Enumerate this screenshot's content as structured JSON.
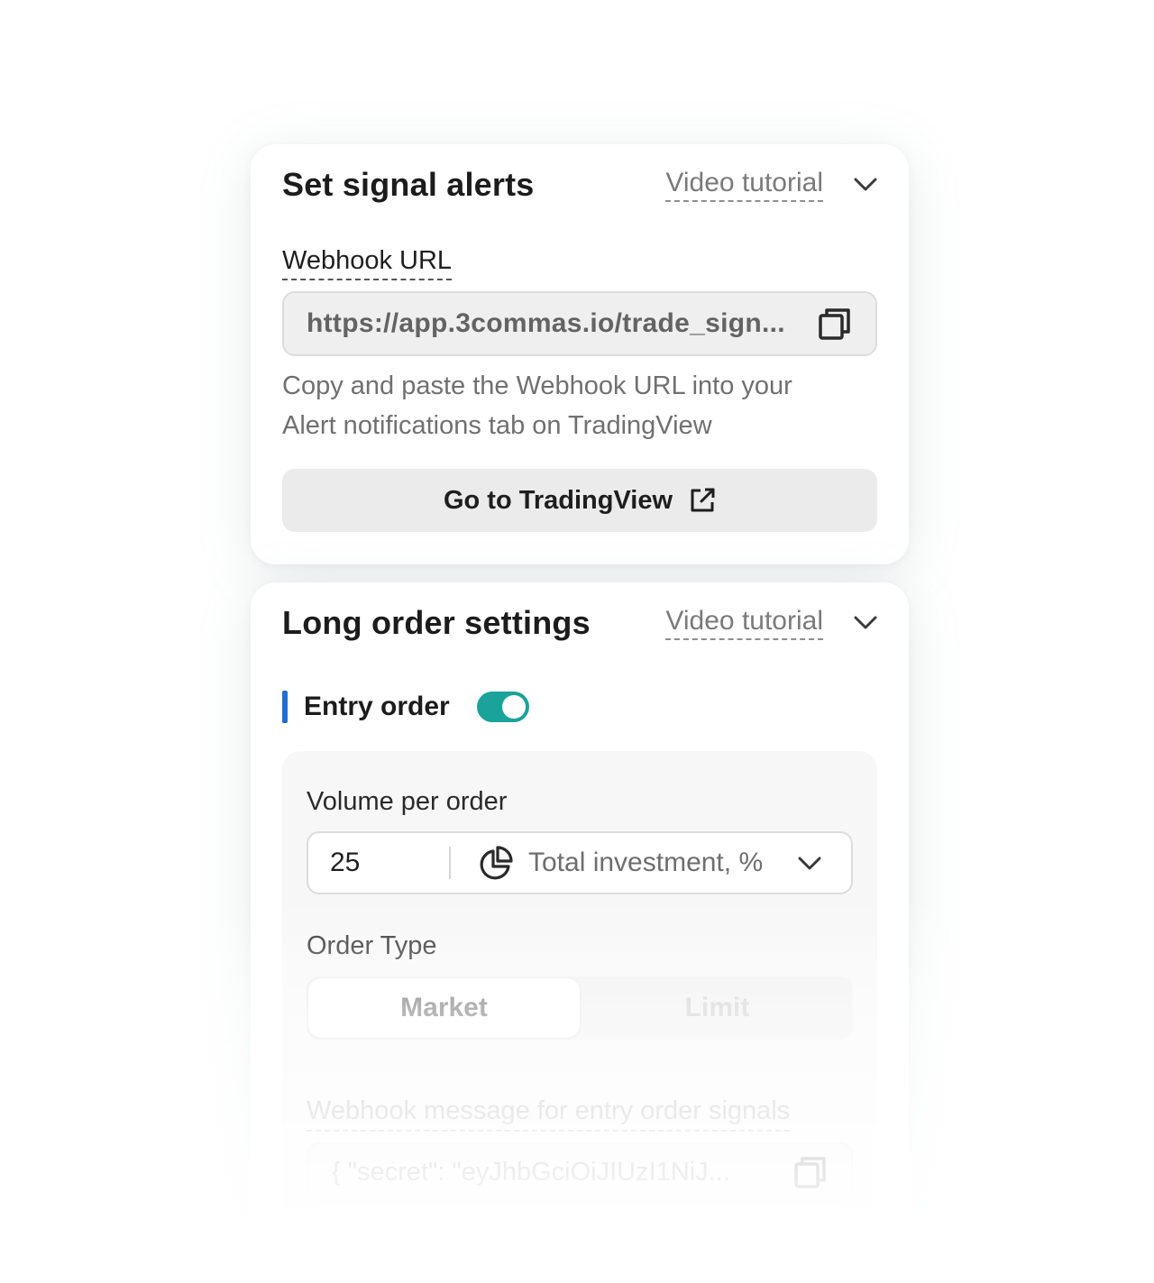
{
  "signal_alerts": {
    "title": "Set signal alerts",
    "video_tutorial": "Video tutorial",
    "webhook_label": "Webhook URL",
    "webhook_url": "https://app.3commas.io/trade_sign...",
    "helper_line1": "Copy and paste the Webhook URL into your",
    "helper_line2": "Alert notifications tab on TradingView",
    "go_button": "Go to TradingView"
  },
  "long_order": {
    "title": "Long order settings",
    "video_tutorial": "Video tutorial",
    "entry_order_label": "Entry order",
    "entry_order_enabled": true,
    "volume_label": "Volume per order",
    "volume_value": "25",
    "volume_unit": "Total investment, %",
    "order_type_label": "Order Type",
    "order_types": [
      "Market",
      "Limit"
    ],
    "order_type_selected": "Market",
    "webhook_message_label": "Webhook message for entry order signals",
    "webhook_message": "{ \"secret\": \"eyJhbGciOiJIUzI1NiJ..."
  },
  "colors": {
    "toggle_on": "#1aa39a",
    "entry_accent": "#1f6fd1"
  },
  "icons": [
    "chevron-down-icon",
    "copy-icon",
    "external-link-icon",
    "pie-chart-icon"
  ]
}
